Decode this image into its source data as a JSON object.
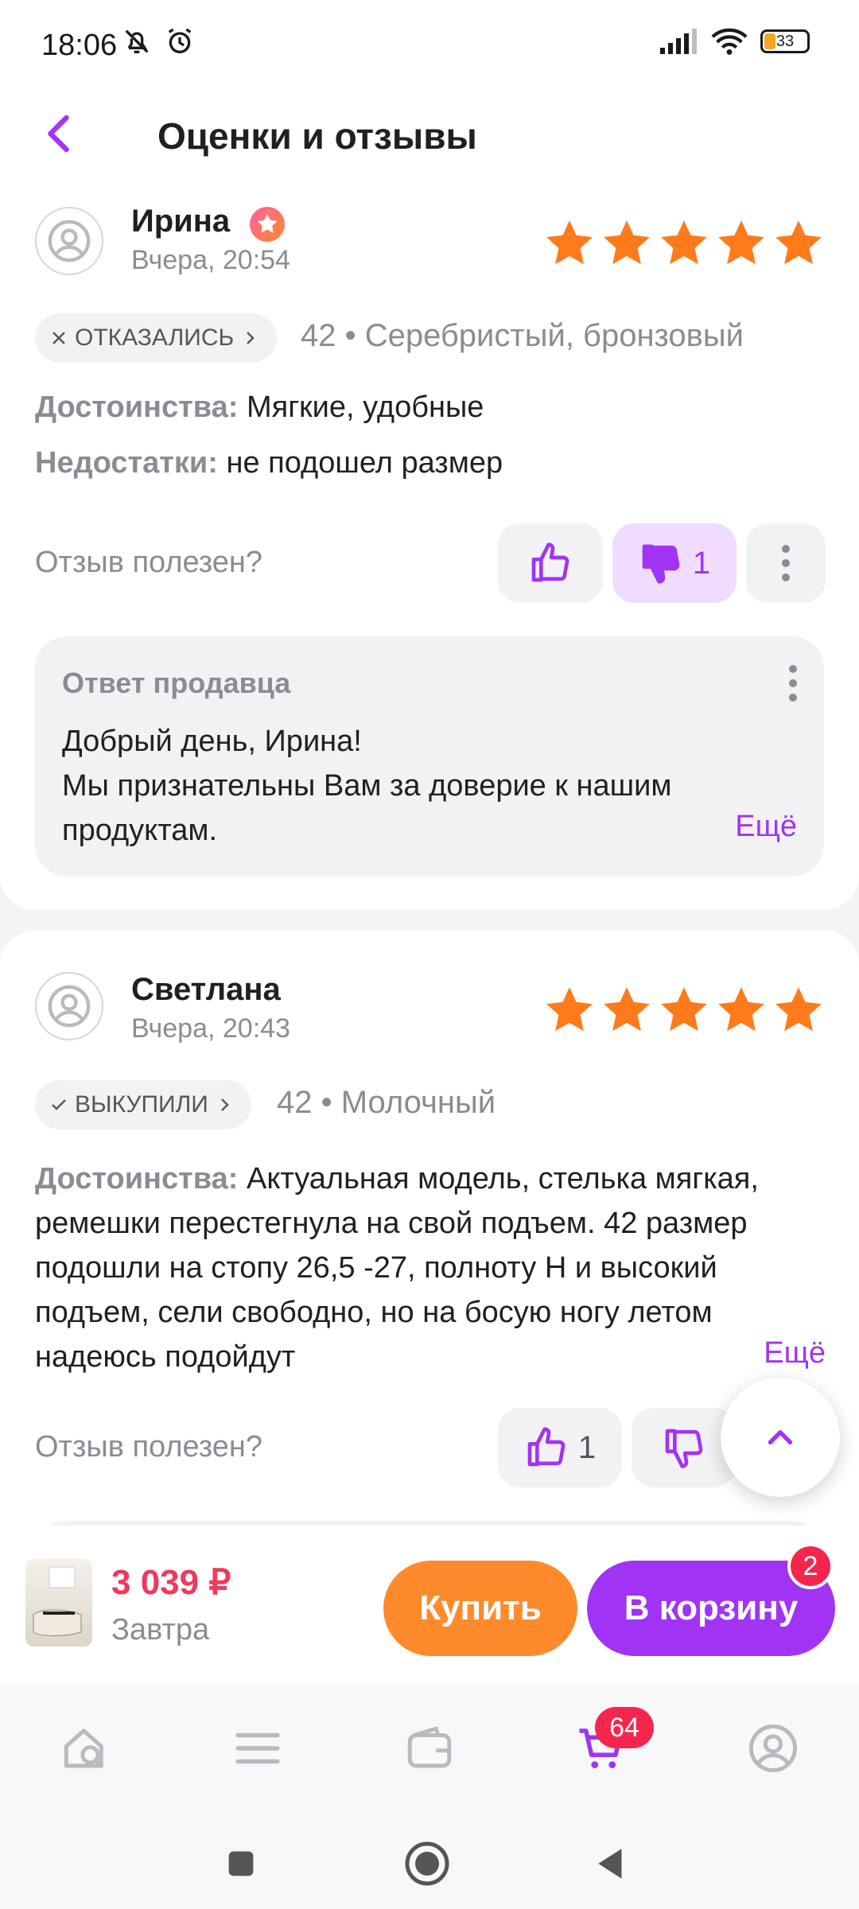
{
  "status_bar": {
    "time": "18:06",
    "battery": "33"
  },
  "header": {
    "title": "Оценки и отзывы"
  },
  "reviews": [
    {
      "author": "Ирина",
      "date": "Вчера, 20:54",
      "rating": 5,
      "status": "ОТКАЗАЛИСЬ",
      "variant": "42 • Серебристый, бронзовый",
      "pros_label": "Достоинства:",
      "pros": "Мягкие, удобные",
      "cons_label": "Недостатки:",
      "cons": "не подошел размер",
      "helpful_question": "Отзыв полезен?",
      "dislike_count": "1",
      "seller_reply": {
        "title": "Ответ продавца",
        "text_line1": "Добрый день, Ирина!",
        "text_line2": "Мы признательны Вам за доверие к нашим продуктам.",
        "more": "Ещё"
      }
    },
    {
      "author": "Светлана",
      "date": "Вчера, 20:43",
      "rating": 5,
      "status": "ВЫКУПИЛИ",
      "variant": "42 • Молочный",
      "pros_label": "Достоинства:",
      "pros": "Актуальная модель, стелька мягкая, ремешки перестегнула на свой подъем. 42 размер подошли на стопу 26,5 -27, полноту Н и высокий подъем, сели свободно, но на босую ногу летом надеюсь подойдут",
      "more": "Ещё",
      "helpful_question": "Отзыв полезен?",
      "like_count": "1"
    }
  ],
  "buy_bar": {
    "price": "3 039 ₽",
    "delivery": "Завтра",
    "buy_label": "Купить",
    "cart_label": "В корзину",
    "cart_count": "2"
  },
  "bottom_nav": {
    "cart_badge": "64"
  },
  "colors": {
    "accent": "#a134f4",
    "star": "#ff7a1a",
    "buy": "#ff8a2b",
    "price": "#ef3a5d",
    "badge": "#f5264d"
  }
}
